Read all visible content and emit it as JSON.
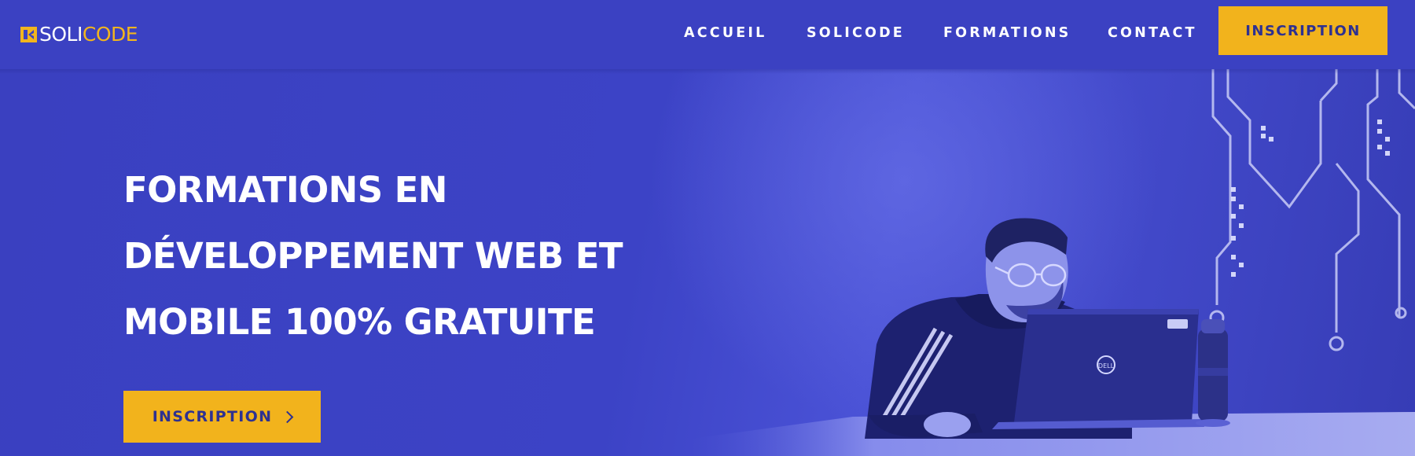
{
  "header": {
    "logo": {
      "word_1": "SOLI",
      "word_2": "CODE",
      "icon": "solicode-logo-mark"
    },
    "nav": [
      {
        "label": "ACCUEIL"
      },
      {
        "label": "SOLICODE"
      },
      {
        "label": "FORMATIONS"
      },
      {
        "label": "CONTACT"
      }
    ],
    "cta_label": "INSCRIPTION"
  },
  "hero": {
    "headline_lines": [
      "FORMATIONS EN",
      "DÉVELOPPEMENT WEB ET",
      "MOBILE 100% GRATUITE"
    ],
    "cta_label": "INSCRIPTION",
    "cta_icon": "chevron-right-icon",
    "laptop_brand": "DELL"
  },
  "colors": {
    "background": "#3b41c1",
    "accent": "#f2b31c",
    "button_text": "#2e3191",
    "text": "#ffffff"
  }
}
